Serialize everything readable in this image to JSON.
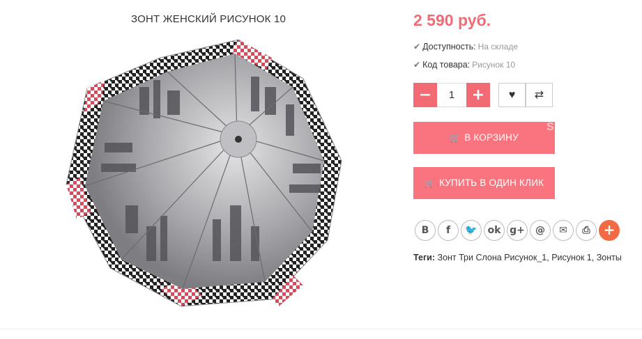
{
  "product": {
    "title": "ЗОНТ ЖЕНСКИЙ РИСУНОК 10",
    "price": "2 590 руб.",
    "availability_label": "Доступность:",
    "availability_value": "На складе",
    "code_label": "Код товара:",
    "code_value": "Рисунок 10",
    "image_icon": "umbrella-photo"
  },
  "quantity": {
    "value": "1",
    "minus_label": "−",
    "plus_label": "+"
  },
  "actions": {
    "wishlist_icon": "heart-icon",
    "compare_icon": "compare-arrows-icon",
    "add_to_cart": "В КОРЗИНУ",
    "buy_one_click": "КУПИТЬ В ОДИН КЛИК",
    "corner_badge": "S"
  },
  "share": {
    "icons": [
      {
        "name": "vk-icon",
        "glyph": "B"
      },
      {
        "name": "facebook-icon",
        "glyph": "f"
      },
      {
        "name": "twitter-icon",
        "glyph": "🐦"
      },
      {
        "name": "odnoklassniki-icon",
        "glyph": "ok"
      },
      {
        "name": "google-plus-icon",
        "glyph": "g+"
      },
      {
        "name": "mailru-icon",
        "glyph": "@"
      },
      {
        "name": "email-icon",
        "glyph": "✉"
      },
      {
        "name": "print-icon",
        "glyph": "⎙"
      },
      {
        "name": "more-icon",
        "glyph": "+"
      }
    ]
  },
  "tags": {
    "label": "Теги:",
    "value": "Зонт Три Слона Рисунок_1, Рисунок 1, Зонты"
  },
  "colors": {
    "accent": "#f26a73",
    "button": "#f9747e",
    "more_button": "#f26a43"
  }
}
